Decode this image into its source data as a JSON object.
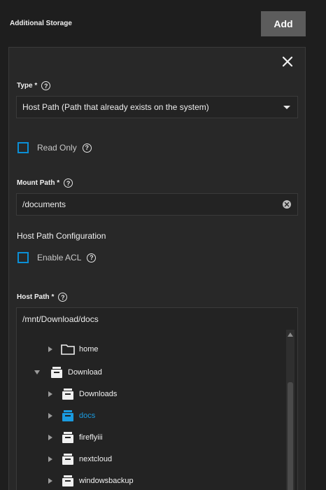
{
  "section": {
    "title": "Additional Storage",
    "add_label": "Add"
  },
  "form": {
    "type_label": "Type *",
    "type_value": "Host Path (Path that already exists on the system)",
    "read_only_label": "Read Only",
    "mount_path_label": "Mount Path *",
    "mount_path_value": "/documents",
    "host_path_config_heading": "Host Path Configuration",
    "enable_acl_label": "Enable ACL",
    "host_path_label": "Host Path *",
    "host_path_value": "/mnt/Download/docs"
  },
  "help_glyph": "?",
  "tree": {
    "items": [
      {
        "label": "home",
        "icon": "folder-icon",
        "level": 1,
        "expanded": false,
        "selected": false
      },
      {
        "label": "Download",
        "icon": "dataset-icon",
        "level": 0,
        "expanded": true,
        "selected": false
      },
      {
        "label": "Downloads",
        "icon": "dataset-icon",
        "level": 1,
        "expanded": false,
        "selected": false
      },
      {
        "label": "docs",
        "icon": "dataset-icon",
        "level": 1,
        "expanded": false,
        "selected": true
      },
      {
        "label": "fireflyiii",
        "icon": "dataset-icon",
        "level": 1,
        "expanded": false,
        "selected": false
      },
      {
        "label": "nextcloud",
        "icon": "dataset-icon",
        "level": 1,
        "expanded": false,
        "selected": false
      },
      {
        "label": "windowsbackup",
        "icon": "dataset-icon",
        "level": 1,
        "expanded": false,
        "selected": false
      }
    ]
  },
  "colors": {
    "accent": "#0b8fd6",
    "selected_text": "#1a9be0",
    "background": "#1e1e1e",
    "card": "#282828"
  }
}
